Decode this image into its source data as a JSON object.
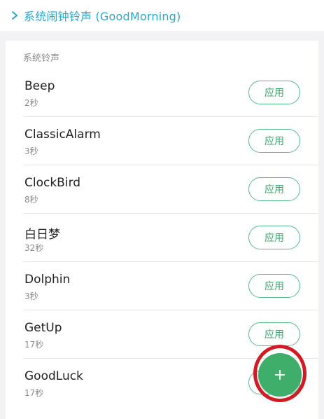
{
  "header": {
    "title": "系统闹钟铃声 (GoodMorning)",
    "chevron_icon": "chevron-right-icon"
  },
  "section": {
    "title": "系统铃声"
  },
  "ringtones": [
    {
      "name": "Beep",
      "duration": "2秒",
      "action": "应用"
    },
    {
      "name": "ClassicAlarm",
      "duration": "3秒",
      "action": "应用"
    },
    {
      "name": "ClockBird",
      "duration": "8秒",
      "action": "应用"
    },
    {
      "name": "白日梦",
      "duration": "32秒",
      "action": "应用"
    },
    {
      "name": "Dolphin",
      "duration": "3秒",
      "action": "应用"
    },
    {
      "name": "GetUp",
      "duration": "17秒",
      "action": "应用"
    },
    {
      "name": "GoodLuck",
      "duration": "17秒",
      "action": "应用"
    }
  ],
  "fab": {
    "label": "+",
    "icon": "plus-icon"
  },
  "colors": {
    "accent_title": "#2aa6c9",
    "button_green": "#3da56f",
    "fab_green": "#3fae6b",
    "annotation_red": "#d11c26"
  }
}
